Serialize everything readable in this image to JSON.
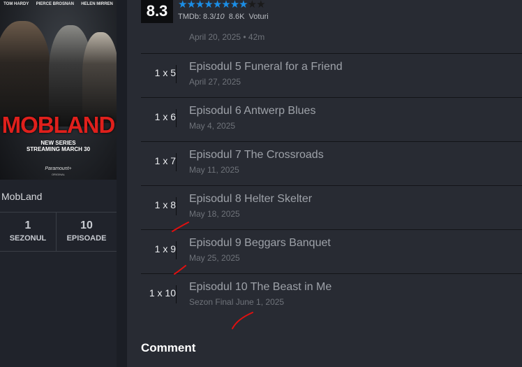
{
  "poster": {
    "actors": [
      "TOM HARDY",
      "PIERCE BROSNAN",
      "HELEN MIRREN"
    ],
    "title": "MOBLAND",
    "tagline1": "NEW SERIES",
    "tagline2": "STREAMING MARCH 30",
    "brand": "Paramount+",
    "brand_sub": "ORIGINAL"
  },
  "show": {
    "name": "MobLand",
    "stats": [
      {
        "value": "1",
        "label": "SEZONUL"
      },
      {
        "value": "10",
        "label": "EPISOADE"
      }
    ]
  },
  "rating": {
    "score": "8.3",
    "stars_filled": 8,
    "stars_total": 10,
    "tmdb_prefix": "TMDb: 8.3/",
    "tmdb_max": "10",
    "votes": "8.6K",
    "votes_label": "Voturi",
    "star_color": "#1b8ee6"
  },
  "episodes": [
    {
      "code": "",
      "title": "",
      "date": "April 20, 2025 • 42m"
    },
    {
      "code": "1 x 5",
      "title": "Episodul 5 Funeral for a Friend",
      "date": "April 27, 2025"
    },
    {
      "code": "1 x 6",
      "title": "Episodul 6 Antwerp Blues",
      "date": "May 4, 2025"
    },
    {
      "code": "1 x 7",
      "title": "Episodul 7 The Crossroads",
      "date": "May 11, 2025"
    },
    {
      "code": "1 x 8",
      "title": "Episodul 8 Helter Skelter",
      "date": "May 18, 2025"
    },
    {
      "code": "1 x 9",
      "title": "Episodul 9 Beggars Banquet",
      "date": "May 25, 2025"
    },
    {
      "code": "1 x 10",
      "title": "Episodul 10 The Beast in Me",
      "date": "Sezon Final June 1, 2025"
    }
  ],
  "comment_heading": "Comment",
  "annotation_color": "#e01010"
}
